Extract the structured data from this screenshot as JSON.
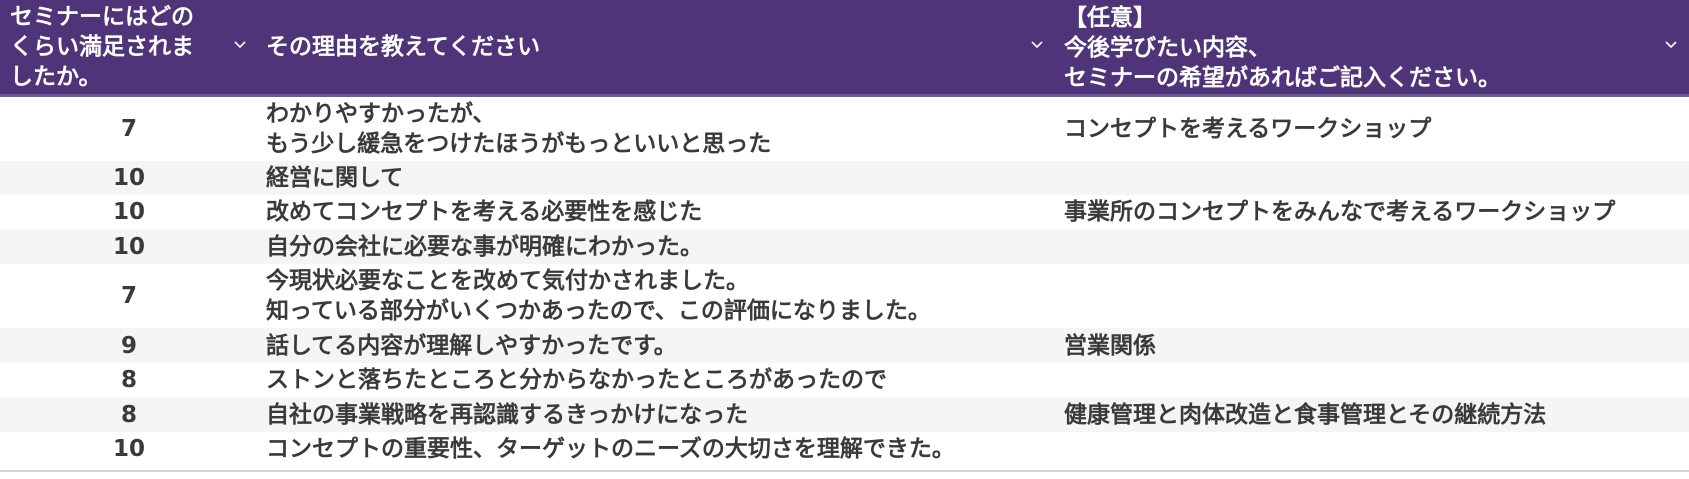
{
  "table": {
    "columns": [
      {
        "label": "セミナーにはどの\nくらい満足されま\nしたか。"
      },
      {
        "label": "その理由を教えてください"
      },
      {
        "label": "【任意】\n今後学びたい内容、\nセミナーの希望があればご記入ください。"
      }
    ],
    "rows": [
      {
        "score": "7",
        "reason": "わかりやすかったが、\nもう少し緩急をつけたほうがもっといいと思った",
        "wish": "コンセプトを考えるワークショップ"
      },
      {
        "score": "10",
        "reason": "経営に関して",
        "wish": ""
      },
      {
        "score": "10",
        "reason": "改めてコンセプトを考える必要性を感じた",
        "wish": "事業所のコンセプトをみんなで考えるワークショップ"
      },
      {
        "score": "10",
        "reason": "自分の会社に必要な事が明確にわかった。",
        "wish": ""
      },
      {
        "score": "7",
        "reason": "今現状必要なことを改めて気付かされました。\n知っている部分がいくつかあったので、この評価になりました。",
        "wish": ""
      },
      {
        "score": "9",
        "reason": "話してる内容が理解しやすかったです。",
        "wish": "営業関係"
      },
      {
        "score": "8",
        "reason": "ストンと落ちたところと分からなかったところがあったので",
        "wish": ""
      },
      {
        "score": "8",
        "reason": "自社の事業戦略を再認識するきっかけになった",
        "wish": "健康管理と肉体改造と食事管理とその継続方法"
      },
      {
        "score": "10",
        "reason": "コンセプトの重要性、ターゲットのニーズの大切さを理解できた。",
        "wish": ""
      }
    ]
  },
  "icons": {
    "sort_dropdown": "chevron-down-icon"
  },
  "colors": {
    "header_background": "#4f3479",
    "header_text": "#ffffff",
    "body_text": "#3a3a3a",
    "alt_row": "#f5f5f7"
  }
}
